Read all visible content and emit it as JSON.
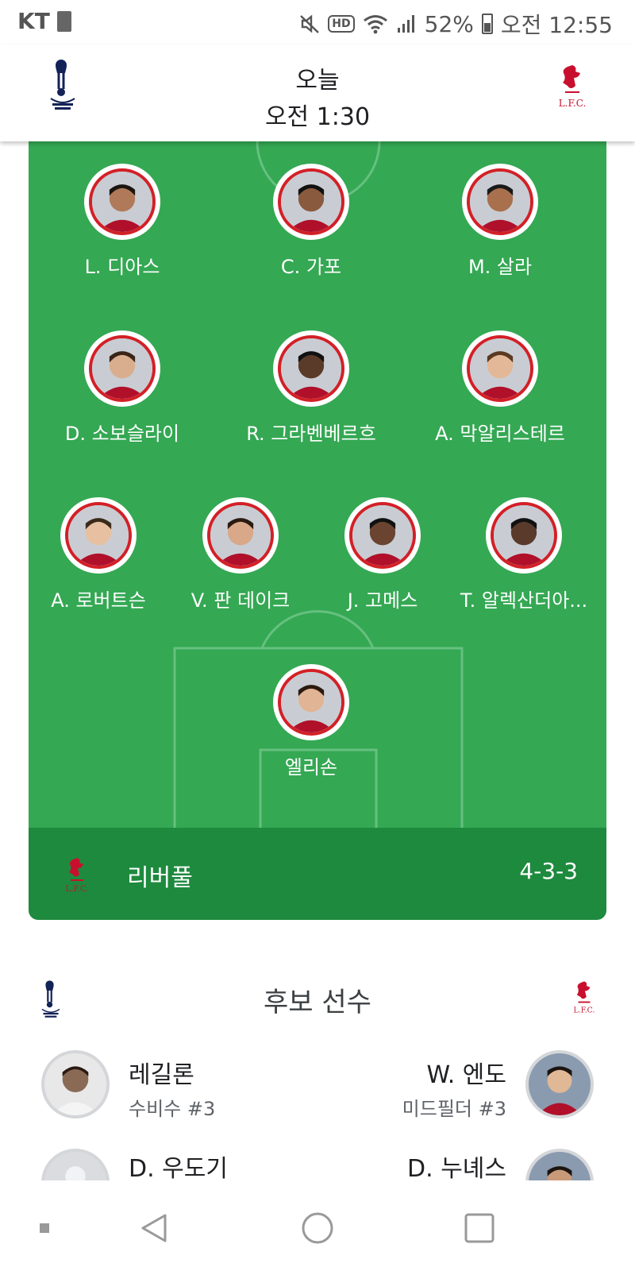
{
  "status_bar": {
    "carrier": "KT",
    "battery": "52%",
    "time": "오전 12:55",
    "icons": [
      "battery-saver-icon",
      "mute-icon",
      "hd-voice-icon",
      "wifi-icon",
      "signal-icon",
      "battery-icon"
    ]
  },
  "match": {
    "day": "오늘",
    "time": "오전 1:30",
    "home_crest": "tottenham-crest-icon",
    "away_crest": "liverpool-crest-icon"
  },
  "lineup": {
    "team_name": "리버풀",
    "formation": "4-3-3",
    "accent": "#d32027",
    "rows": [
      [
        {
          "name": "L. 디아스"
        },
        {
          "name": "C. 가포"
        },
        {
          "name": "M. 살라"
        }
      ],
      [
        {
          "name": "D. 소보슬라이"
        },
        {
          "name": "R. 그라벤베르흐"
        },
        {
          "name": "A. 막알리스테르"
        }
      ],
      [
        {
          "name": "A. 로버트슨"
        },
        {
          "name": "V. 판 데이크"
        },
        {
          "name": "J. 고메스"
        },
        {
          "name": "T. 알렉산더아..."
        }
      ],
      [
        {
          "name": "엘리손"
        }
      ]
    ]
  },
  "substitutes": {
    "title": "후보 선수",
    "home": [
      {
        "name": "레길론",
        "position": "수비수 #3"
      },
      {
        "name": "D. 우도기",
        "position": ""
      }
    ],
    "away": [
      {
        "name": "W. 엔도",
        "position": "미드필더 #3"
      },
      {
        "name": "D. 누녜스",
        "position": ""
      }
    ]
  },
  "nav": {
    "icons": [
      "recents-icon",
      "back-icon",
      "home-icon",
      "overview-icon"
    ]
  }
}
